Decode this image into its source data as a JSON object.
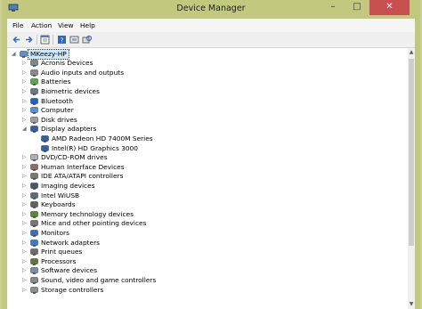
{
  "window": {
    "title": "Device Manager",
    "minimize_glyph": "–",
    "maximize_glyph": "□",
    "close_glyph": "✕"
  },
  "menu": [
    "File",
    "Action",
    "View",
    "Help"
  ],
  "toolbar": {
    "icons": [
      "back-arrow-icon",
      "forward-arrow-icon",
      "properties-icon",
      "help-icon",
      "show-hidden-icon",
      "scan-hardware-icon"
    ]
  },
  "tree": {
    "root": {
      "label": "MKeezy-HP",
      "icon": "computer-icon",
      "expander": "◢"
    },
    "categories": [
      {
        "label": "Acronis Devices",
        "icon": "device-icon",
        "expander": "▷"
      },
      {
        "label": "Audio inputs and outputs",
        "icon": "speaker-icon",
        "expander": "▷"
      },
      {
        "label": "Batteries",
        "icon": "battery-icon",
        "expander": "▷"
      },
      {
        "label": "Biometric devices",
        "icon": "fingerprint-icon",
        "expander": "▷"
      },
      {
        "label": "Bluetooth",
        "icon": "bluetooth-icon",
        "expander": "▷"
      },
      {
        "label": "Computer",
        "icon": "computer-icon",
        "expander": "▷"
      },
      {
        "label": "Disk drives",
        "icon": "disk-icon",
        "expander": "▷"
      },
      {
        "label": "Display adapters",
        "icon": "display-icon",
        "expander": "◢",
        "children": [
          {
            "label": "AMD Radeon HD 7400M Series",
            "icon": "display-icon"
          },
          {
            "label": "Intel(R) HD Graphics 3000",
            "icon": "display-icon"
          }
        ]
      },
      {
        "label": "DVD/CD-ROM drives",
        "icon": "dvd-icon",
        "expander": "▷"
      },
      {
        "label": "Human Interface Devices",
        "icon": "hid-icon",
        "expander": "▷"
      },
      {
        "label": "IDE ATA/ATAPI controllers",
        "icon": "controller-icon",
        "expander": "▷"
      },
      {
        "label": "Imaging devices",
        "icon": "camera-icon",
        "expander": "▷"
      },
      {
        "label": "Intel WiUSB",
        "icon": "usb-icon",
        "expander": "▷"
      },
      {
        "label": "Keyboards",
        "icon": "keyboard-icon",
        "expander": "▷"
      },
      {
        "label": "Memory technology devices",
        "icon": "memory-icon",
        "expander": "▷"
      },
      {
        "label": "Mice and other pointing devices",
        "icon": "mouse-icon",
        "expander": "▷"
      },
      {
        "label": "Monitors",
        "icon": "monitor-icon",
        "expander": "▷"
      },
      {
        "label": "Network adapters",
        "icon": "network-icon",
        "expander": "▷"
      },
      {
        "label": "Print queues",
        "icon": "printer-icon",
        "expander": "▷"
      },
      {
        "label": "Processors",
        "icon": "processor-icon",
        "expander": "▷"
      },
      {
        "label": "Software devices",
        "icon": "software-icon",
        "expander": "▷"
      },
      {
        "label": "Sound, video and game controllers",
        "icon": "sound-icon",
        "expander": "▷"
      },
      {
        "label": "Storage controllers",
        "icon": "storage-icon",
        "expander": "▷"
      }
    ]
  },
  "scrollbar": {
    "up_glyph": "▲",
    "down_glyph": "▼"
  },
  "colors": {
    "desktop": "#c9cf95",
    "frame": "#c2c87e",
    "close_button": "#c75050",
    "selection": "#cce8ff"
  }
}
